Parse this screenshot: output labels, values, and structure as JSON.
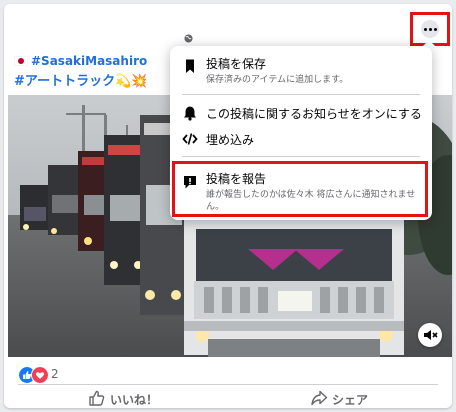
{
  "post": {
    "hashtag1": "#SasakiMasahiro",
    "hashtag2": "#アートトラック",
    "hashtag2_emoji": "💫💥",
    "reaction_count": "2"
  },
  "menu": {
    "items": [
      {
        "title": "投稿を保存",
        "subtitle": "保存済みのアイテムに追加します。",
        "icon": "bookmark-icon"
      },
      {
        "title": "この投稿に関するお知らせをオンにする",
        "icon": "bell-icon"
      },
      {
        "title": "埋め込み",
        "icon": "code-icon"
      },
      {
        "title": "投稿を報告",
        "subtitle_line1": "誰が報告したのかは佐々木 将広さんに通知されませ",
        "subtitle_line2": "ん。",
        "icon": "report-icon"
      }
    ]
  },
  "actions": {
    "like_label": "いいね！",
    "share_label": "シェア"
  },
  "colors": {
    "highlight": "#e01414",
    "link": "#216fdb",
    "like_blue": "#1877f2",
    "love_red": "#f33e58"
  }
}
